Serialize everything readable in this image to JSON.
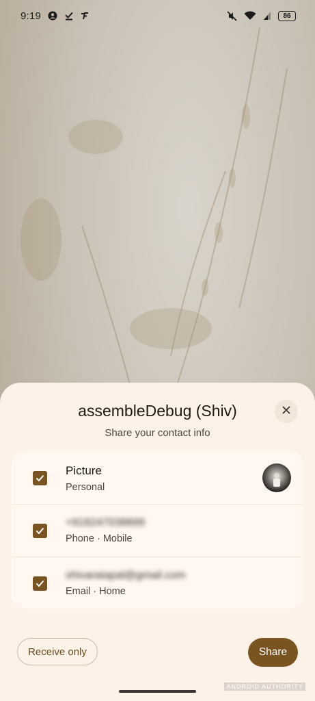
{
  "status_bar": {
    "time": "9:19",
    "battery": "86",
    "left_icons": [
      "account-circle-icon",
      "check-done-icon",
      "app-f-icon"
    ],
    "right_icons": [
      "mute-vibrate-icon",
      "wifi-icon",
      "signal-icon"
    ]
  },
  "sheet": {
    "title": "assembleDebug (Shiv)",
    "subtitle": "Share your contact info",
    "items": [
      {
        "primary": "Picture",
        "secondary": "Personal",
        "checked": true,
        "blurred": false
      },
      {
        "primary": "+918247038899",
        "secondary": "Phone · Mobile",
        "checked": true,
        "blurred": true
      },
      {
        "primary": "shivaratapal@gmail.com",
        "secondary": "Email · Home",
        "checked": true,
        "blurred": true
      }
    ],
    "receive_only_label": "Receive only",
    "share_label": "Share"
  },
  "watermark": "ANDROID AUTHORITY",
  "colors": {
    "accent": "#7a5420",
    "sheet_bg": "#fdf2e8",
    "card_bg": "#fff7f0"
  }
}
